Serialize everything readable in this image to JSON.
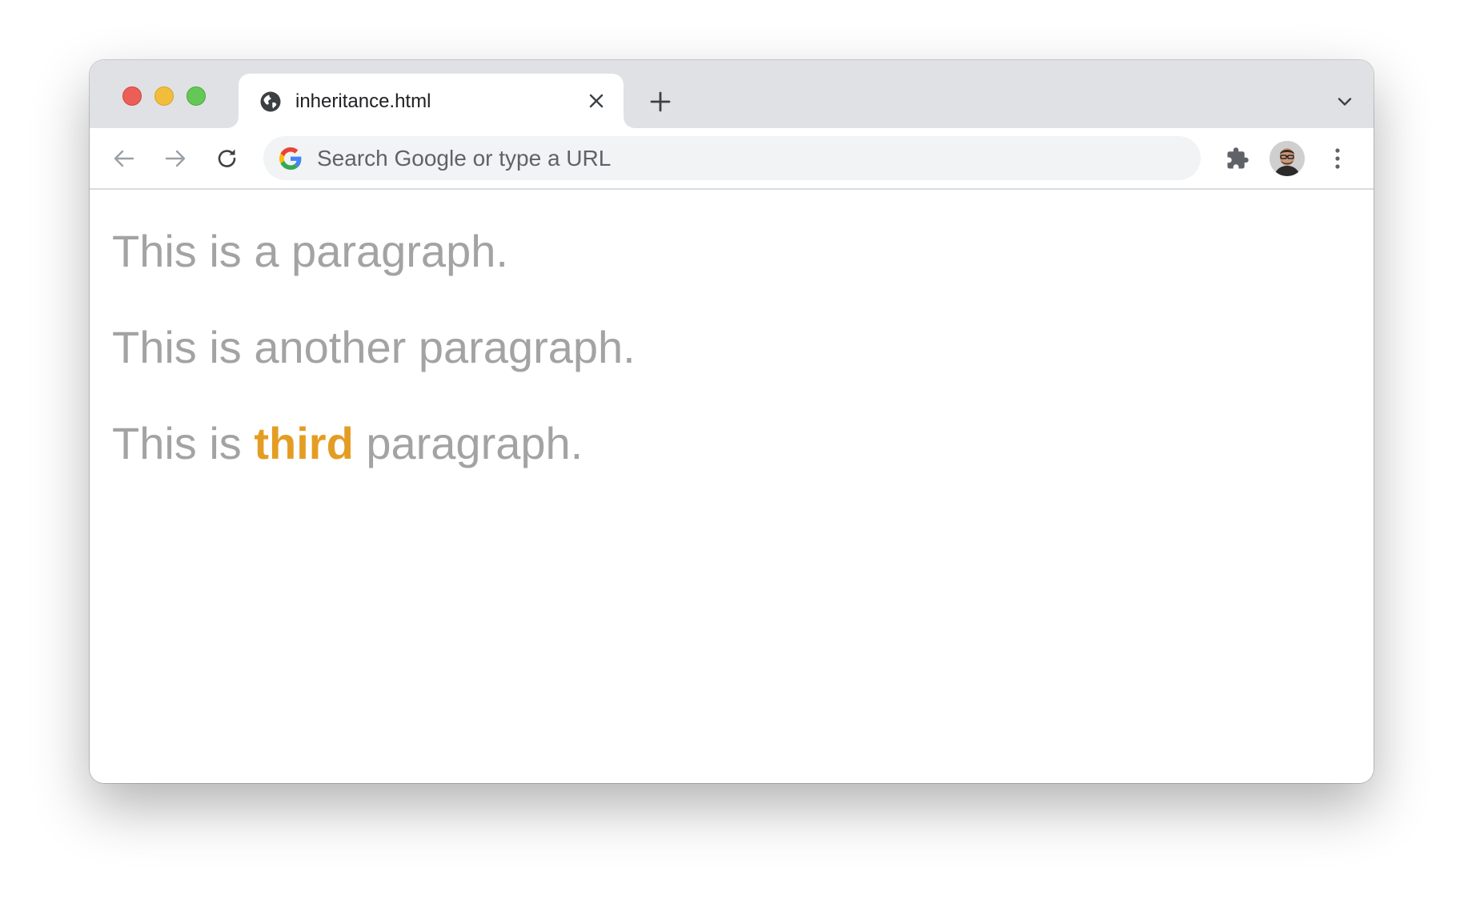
{
  "window": {
    "controls": [
      "close",
      "minimize",
      "zoom"
    ]
  },
  "tab": {
    "title": "inheritance.html",
    "favicon": "globe-icon",
    "close_icon": "close-icon"
  },
  "tabstrip": {
    "new_tab_icon": "plus-icon",
    "tab_search_icon": "chevron-down-icon"
  },
  "toolbar": {
    "back_icon": "arrow-left-icon",
    "forward_icon": "arrow-right-icon",
    "reload_icon": "reload-icon",
    "omnibox": {
      "placeholder": "Search Google or type a URL",
      "value": "",
      "icon": "google-icon"
    },
    "extensions_icon": "puzzle-icon",
    "menu_icon": "kebab-menu-icon"
  },
  "page": {
    "paragraphs": [
      {
        "text": "This is a paragraph."
      },
      {
        "text": "This is another paragraph."
      },
      {
        "before": "This is ",
        "strong": "third",
        "after": " paragraph."
      }
    ]
  },
  "colors": {
    "paragraph_text": "#a3a3a3",
    "highlight": "#e49d23",
    "tabstrip_bg": "#dfe1e5",
    "omnibox_bg": "#f1f3f4"
  }
}
